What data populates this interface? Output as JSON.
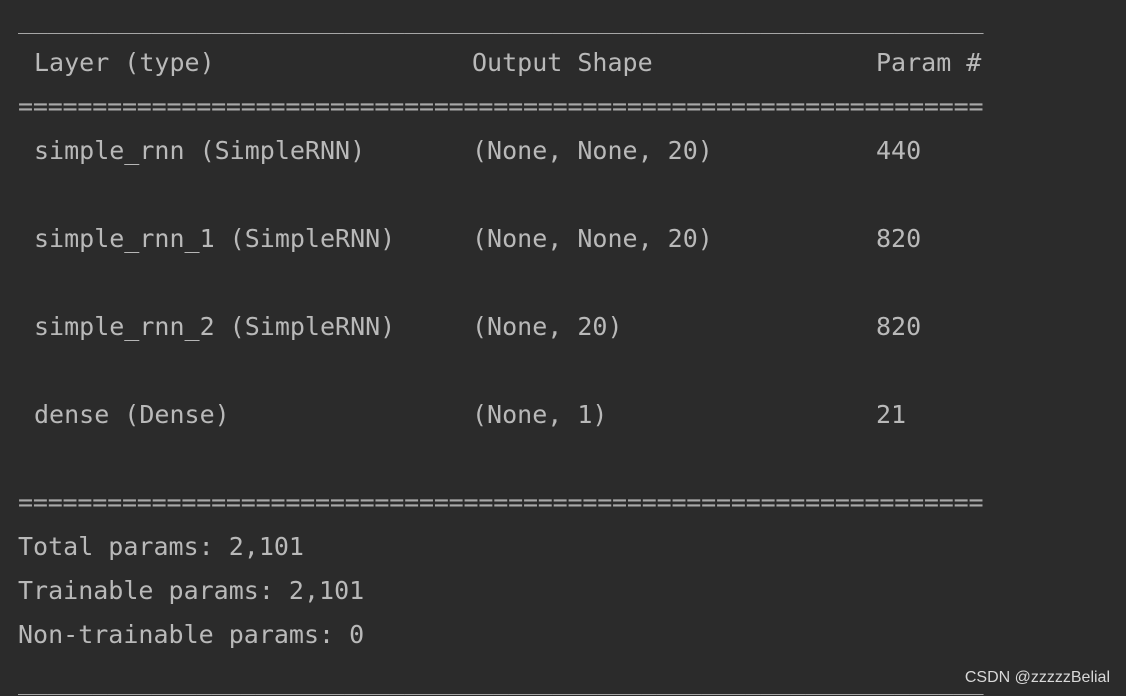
{
  "rules": {
    "dash": "_________________________________________________________________",
    "equals": "================================================================="
  },
  "header": {
    "layer": "Layer (type)",
    "output_shape": "Output Shape",
    "params": "Param #"
  },
  "layers": [
    {
      "name": "simple_rnn (SimpleRNN)",
      "shape": "(None, None, 20)",
      "params": "440"
    },
    {
      "name": "simple_rnn_1 (SimpleRNN)",
      "shape": "(None, None, 20)",
      "params": "820"
    },
    {
      "name": "simple_rnn_2 (SimpleRNN)",
      "shape": "(None, 20)",
      "params": "820"
    },
    {
      "name": "dense (Dense)",
      "shape": "(None, 1)",
      "params": "21"
    }
  ],
  "summary": {
    "total": "Total params: 2,101",
    "trainable": "Trainable params: 2,101",
    "non_trainable": "Non-trainable params: 0"
  },
  "watermark": "CSDN @zzzzzBelial"
}
